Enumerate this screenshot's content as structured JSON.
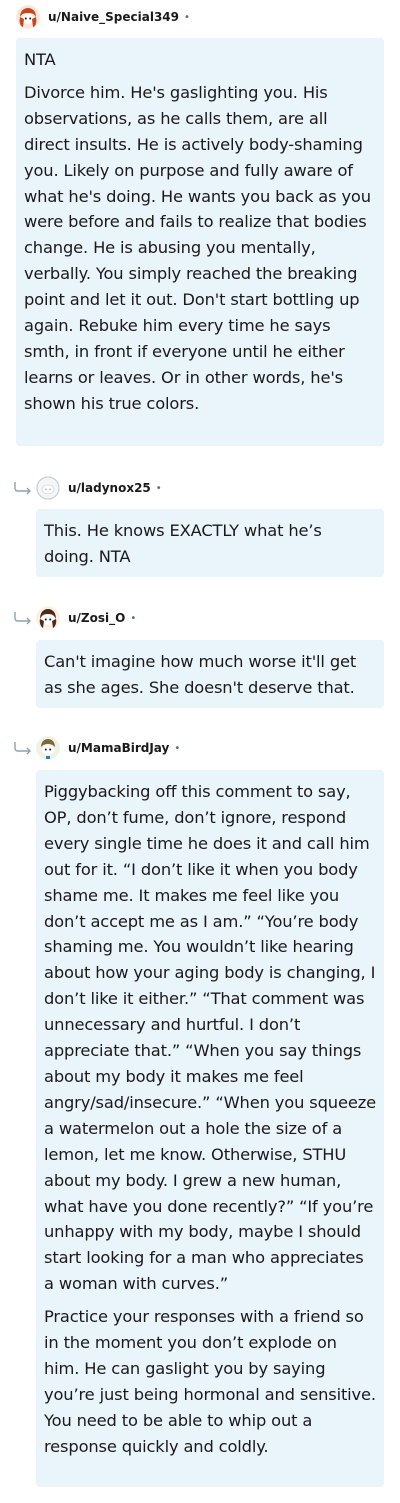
{
  "comments": [
    {
      "username": "u/Naive_Special349",
      "separator": "•",
      "avatar": "reddit-snoo-red-hair-avatar",
      "paragraphs": [
        "NTA",
        "Divorce him. He's gaslighting you. His observations, as he calls them, are all direct insults. He is actively body-shaming you. Likely on purpose and fully aware of what he's doing. He wants you back as you were before and fails to realize that bodies change. He is abusing you mentally, verbally. You simply reached the breaking point and let it out. Don't start bottling up again. Rebuke him every time he says smth, in front if everyone until he either learns or leaves. Or in other words, he's shown his true colors."
      ]
    },
    {
      "username": "u/ladynox25",
      "separator": "•",
      "avatar": "default-gray-avatar",
      "paragraphs": [
        "This. He knows EXACTLY what he’s doing. NTA"
      ]
    },
    {
      "username": "u/Zosi_O",
      "separator": "•",
      "avatar": "reddit-snoo-brown-hair-avatar",
      "paragraphs": [
        "Can't imagine how much worse it'll get as she ages. She doesn't deserve that."
      ]
    },
    {
      "username": "u/MamaBirdJay",
      "separator": "•",
      "avatar": "reddit-snoo-mixed-avatar",
      "paragraphs": [
        "Piggybacking off this comment to say, OP, don’t fume, don’t ignore, respond every single time he does it and call him out for it. “I don’t like it when you body shame me. It makes me feel like you don’t accept me as I am.” “You’re body shaming me. You wouldn’t like hearing about how your aging body is changing, I don’t like it either.” “That comment was unnecessary and hurtful. I don’t appreciate that.” “When you say things about my body it makes me feel angry/sad/insecure.” “When you squeeze a watermelon out a hole the size of a lemon, let me know. Otherwise, STHU about my body. I grew a new human, what have you done recently?” “If you’re unhappy with my body, maybe I should start looking for a man who appreciates a woman with curves.”",
        "Practice your responses with a friend so in the moment you don’t explode on him. He can gaslight you by saying you’re just being hormonal and sensitive. You need to be able to whip out a response quickly and coldly."
      ]
    }
  ],
  "colors": {
    "bubble_background": "#eaf4fb",
    "text": "#1a1a1b",
    "meta": "#576f76",
    "reply_arrow": "#8ea3ad"
  }
}
